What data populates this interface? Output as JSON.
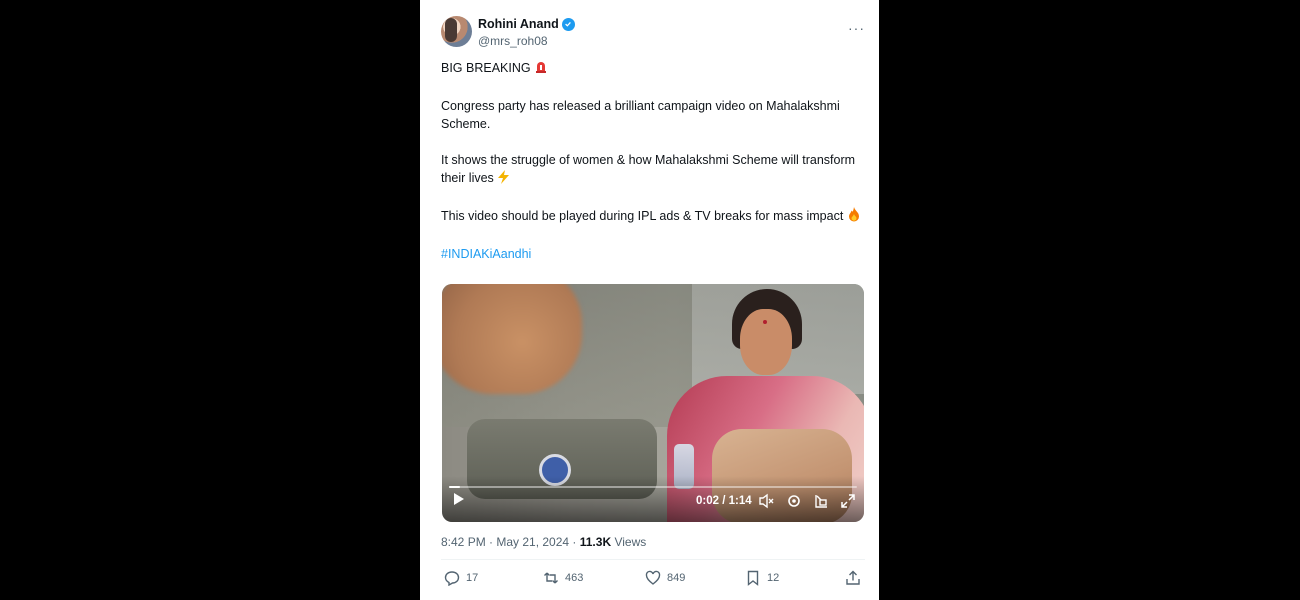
{
  "tweet": {
    "author_name": "Rohini Anand",
    "handle": "@mrs_roh08",
    "line1": "BIG BREAKING",
    "para2": "Congress party has released a brilliant campaign video on Mahalakshmi Scheme.",
    "para3": "It shows the struggle of women & how Mahalakshmi Scheme will transform their lives",
    "para4": "This video should be played during IPL ads & TV breaks for mass impact",
    "hashtag": "#INDIAKiAandhi",
    "time": "8:42 PM · May 21, 2024 ·",
    "views_count": "11.3K",
    "views_label": "Views"
  },
  "video": {
    "time": "0:02 / 1:14",
    "progress": 0.027
  },
  "actions": {
    "replies": "17",
    "reposts": "463",
    "likes": "849",
    "bookmarks": "12"
  },
  "colors": {
    "accent": "#1d9bf0",
    "text": "#0f1419",
    "muted": "#536471",
    "background_outer": "#000000"
  },
  "icons": [
    "verified-badge-icon",
    "more-icon",
    "siren-emoji",
    "lightning-emoji",
    "fire-emoji",
    "play-icon",
    "captions-icon",
    "settings-icon",
    "pip-icon",
    "fullscreen-icon",
    "reply-icon",
    "repost-icon",
    "like-icon",
    "bookmark-icon",
    "share-icon"
  ]
}
